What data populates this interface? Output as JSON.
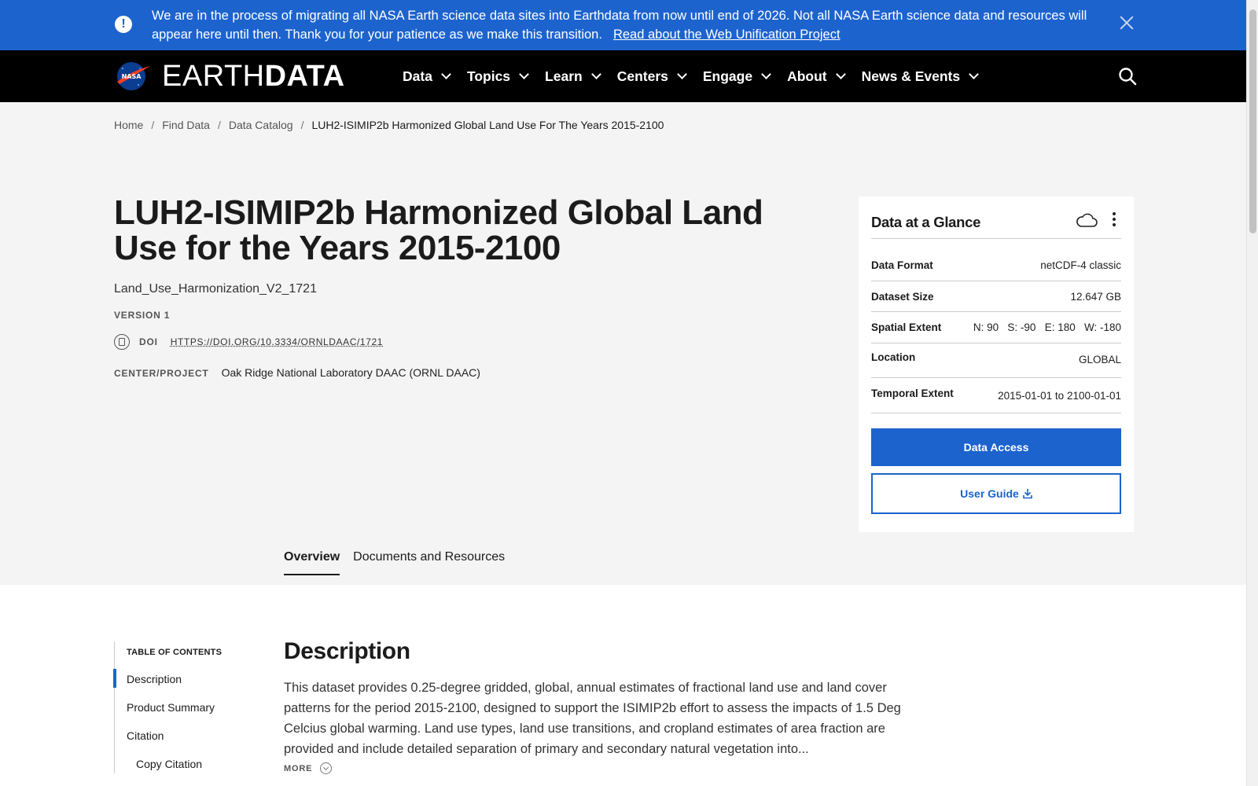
{
  "banner": {
    "text": "We are in the process of migrating all NASA Earth science data sites into Earthdata from now until end of 2026. Not all NASA Earth science data and resources will appear here until then. Thank you for your patience as we make this transition.",
    "link": "Read about the Web Unification Project",
    "icon": "alert-circle-icon",
    "close_icon": "close-icon"
  },
  "header": {
    "logo_text_light": "EARTH",
    "logo_text_bold": "DATA",
    "nasa_label": "NASA",
    "nav": [
      {
        "label": "Data"
      },
      {
        "label": "Topics"
      },
      {
        "label": "Learn"
      },
      {
        "label": "Centers"
      },
      {
        "label": "Engage"
      },
      {
        "label": "About"
      },
      {
        "label": "News & Events"
      }
    ],
    "search_icon": "search-icon"
  },
  "breadcrumb": {
    "items": [
      "Home",
      "Find Data",
      "Data Catalog"
    ],
    "current": "LUH2-ISIMIP2b Harmonized Global Land Use For The Years 2015-2100",
    "separator": "/"
  },
  "dataset": {
    "title": "LUH2-ISIMIP2b Harmonized Global Land Use for the Years 2015-2100",
    "short_name": "Land_Use_Harmonization_V2_1721",
    "version": "VERSION 1",
    "doi_label": "DOI",
    "doi_link": "HTTPS://DOI.ORG/10.3334/ORNLDAAC/1721",
    "center_label": "CENTER/PROJECT",
    "center_value": "Oak Ridge National Laboratory DAAC (ORNL DAAC)"
  },
  "glance": {
    "title": "Data at a Glance",
    "rows": [
      {
        "key": "Data Format",
        "value": "netCDF-4 classic"
      },
      {
        "key": "Dataset Size",
        "value": "12.647 GB"
      },
      {
        "key": "Spatial Extent",
        "value": "N: 90   S: -90   E: 180   W: -180"
      },
      {
        "key": "Location",
        "value": "GLOBAL"
      },
      {
        "key": "Temporal Extent",
        "value": "2015-01-01 to 2100-01-01"
      }
    ],
    "data_access": "Data Access",
    "user_guide": "User Guide",
    "accent": "#1c63ce"
  },
  "tabs": [
    {
      "label": "Overview",
      "active": true
    },
    {
      "label": "Documents and Resources",
      "active": false
    }
  ],
  "toc": {
    "title": "TABLE OF CONTENTS",
    "items": [
      "Description",
      "Product Summary",
      "Citation",
      "Copy Citation"
    ]
  },
  "description": {
    "title": "Description",
    "text": "This dataset provides 0.25-degree gridded, global, annual estimates of fractional land use and land cover patterns for the period 2015-2100, designed to support the ISIMIP2b effort to assess the impacts of 1.5 Deg Celcius global warming. Land use types, land use transitions, and cropland estimates of area fraction are provided and include detailed separation of primary and secondary natural vegetation into...",
    "more": "MORE"
  }
}
